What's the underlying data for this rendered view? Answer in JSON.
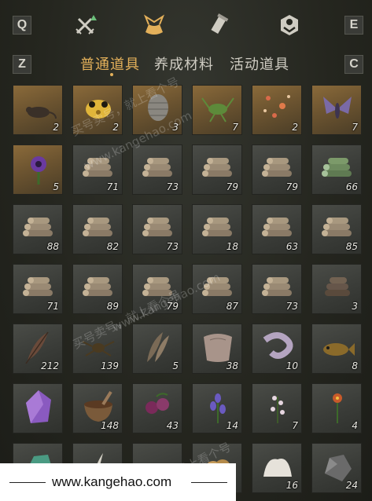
{
  "topbar": {
    "left_key": "Q",
    "right_key": "E",
    "tabs": [
      {
        "icon": "crossed-swords-icon",
        "active": false
      },
      {
        "icon": "pouch-icon",
        "active": true
      },
      {
        "icon": "scroll-icon",
        "active": false
      },
      {
        "icon": "badge-icon",
        "active": false
      }
    ]
  },
  "subtabs": {
    "left_key": "Z",
    "right_key": "C",
    "items": [
      "普通道具",
      "养成材料",
      "活动道具"
    ],
    "active_index": 0
  },
  "inventory": {
    "items": [
      {
        "icon": "rat-icon",
        "qty": "2",
        "rarity": "gold"
      },
      {
        "icon": "golden-toad-icon",
        "qty": "2",
        "rarity": "gold"
      },
      {
        "icon": "hive-icon",
        "qty": "3",
        "rarity": "gold"
      },
      {
        "icon": "cricket-icon",
        "qty": "7",
        "rarity": "gold"
      },
      {
        "icon": "fireflies-icon",
        "qty": "2",
        "rarity": "gold"
      },
      {
        "icon": "moth-icon",
        "qty": "7",
        "rarity": "gold"
      },
      {
        "icon": "purple-flower-icon",
        "qty": "5",
        "rarity": "gold"
      },
      {
        "icon": "logs-icon",
        "qty": "71",
        "rarity": "green"
      },
      {
        "icon": "logs-icon",
        "qty": "73",
        "rarity": "green"
      },
      {
        "icon": "logs-icon",
        "qty": "79",
        "rarity": "green"
      },
      {
        "icon": "logs-icon",
        "qty": "79",
        "rarity": "green"
      },
      {
        "icon": "bamboo-logs-icon",
        "qty": "66",
        "rarity": "green"
      },
      {
        "icon": "logs-icon",
        "qty": "88",
        "rarity": "green"
      },
      {
        "icon": "logs-icon",
        "qty": "82",
        "rarity": "green"
      },
      {
        "icon": "logs-icon",
        "qty": "73",
        "rarity": "green"
      },
      {
        "icon": "logs-icon",
        "qty": "18",
        "rarity": "green"
      },
      {
        "icon": "logs-icon",
        "qty": "63",
        "rarity": "green"
      },
      {
        "icon": "logs-icon",
        "qty": "85",
        "rarity": "green"
      },
      {
        "icon": "logs-icon",
        "qty": "71",
        "rarity": "green"
      },
      {
        "icon": "logs-icon",
        "qty": "89",
        "rarity": "green"
      },
      {
        "icon": "logs-icon",
        "qty": "79",
        "rarity": "green"
      },
      {
        "icon": "logs-icon",
        "qty": "87",
        "rarity": "green"
      },
      {
        "icon": "logs-icon",
        "qty": "73",
        "rarity": "green"
      },
      {
        "icon": "dark-logs-icon",
        "qty": "3",
        "rarity": "green"
      },
      {
        "icon": "feather-icon",
        "qty": "212",
        "rarity": "green"
      },
      {
        "icon": "insect-icon",
        "qty": "139",
        "rarity": "green"
      },
      {
        "icon": "feathers-icon",
        "qty": "5",
        "rarity": "green"
      },
      {
        "icon": "pelt-icon",
        "qty": "38",
        "rarity": "green"
      },
      {
        "icon": "silk-icon",
        "qty": "10",
        "rarity": "green"
      },
      {
        "icon": "fish-icon",
        "qty": "8",
        "rarity": "green"
      },
      {
        "icon": "amethyst-icon",
        "qty": "",
        "rarity": "green"
      },
      {
        "icon": "mortar-bowl-icon",
        "qty": "148",
        "rarity": "green"
      },
      {
        "icon": "berries-icon",
        "qty": "43",
        "rarity": "green"
      },
      {
        "icon": "lavender-icon",
        "qty": "14",
        "rarity": "green"
      },
      {
        "icon": "white-flowers-icon",
        "qty": "7",
        "rarity": "green"
      },
      {
        "icon": "red-flower-icon",
        "qty": "4",
        "rarity": "green"
      },
      {
        "icon": "jade-ore-icon",
        "qty": "",
        "rarity": "green"
      },
      {
        "icon": "quill-icon",
        "qty": "",
        "rarity": "green"
      },
      {
        "icon": "dust-icon",
        "qty": "",
        "rarity": "green"
      },
      {
        "icon": "wool-icon",
        "qty": "",
        "rarity": "green"
      },
      {
        "icon": "coral-icon",
        "qty": "16",
        "rarity": "green"
      },
      {
        "icon": "ore-icon",
        "qty": "24",
        "rarity": "green"
      }
    ]
  },
  "footer": {
    "url": "www.kangehao.com"
  },
  "watermark": {
    "text_a": "买号卖号，就上看个号",
    "text_b": "www.kangehao.com"
  },
  "colors": {
    "accent": "#e3b05a",
    "text": "#cfccc2"
  }
}
